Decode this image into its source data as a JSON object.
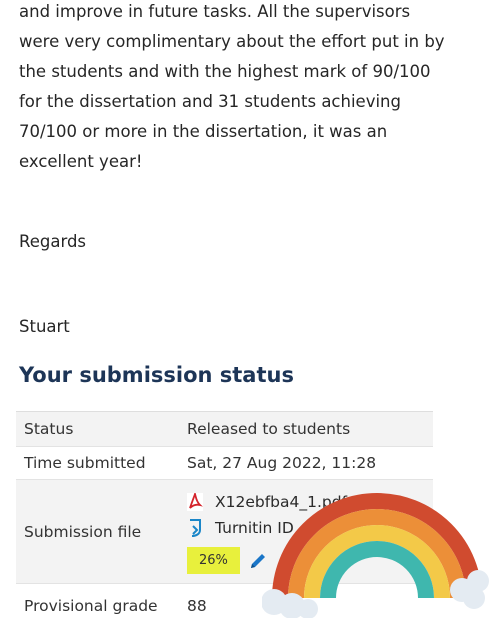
{
  "message": {
    "lines": [
      "and improve in future tasks. All the supervisors",
      "were very complimentary about the effort put in by",
      "the students and with the highest mark of 90/100",
      "for the dissertation and 31 students achieving",
      "70/100 or more in the dissertation, it was an",
      "excellent year!"
    ],
    "regards": "Regards",
    "signoff": "Stuart"
  },
  "submission": {
    "title": "Your submission status",
    "rows": [
      {
        "label": "Status",
        "value": "Released to students"
      },
      {
        "label": "Time submitted",
        "value": "Sat, 27 Aug 2022, 11:28"
      },
      {
        "label": "Submission file",
        "file_name": "X12ebfba4_1.pdf",
        "turnitin_label": "Turnitin ID",
        "similarity": "26%"
      },
      {
        "label": "Provisional grade",
        "value": "88"
      }
    ]
  },
  "icons": {
    "file": "pdf-icon",
    "turnitin": "turnitin-icon",
    "edit": "pencil-icon",
    "sticker": "rainbow-sticker"
  },
  "colors": {
    "heading": "#1d3557",
    "similarity_badge": "#e8f03c",
    "pdf_red": "#d4232b",
    "turnitin_blue": "#1a86c8",
    "pencil_blue": "#1a76c8"
  }
}
